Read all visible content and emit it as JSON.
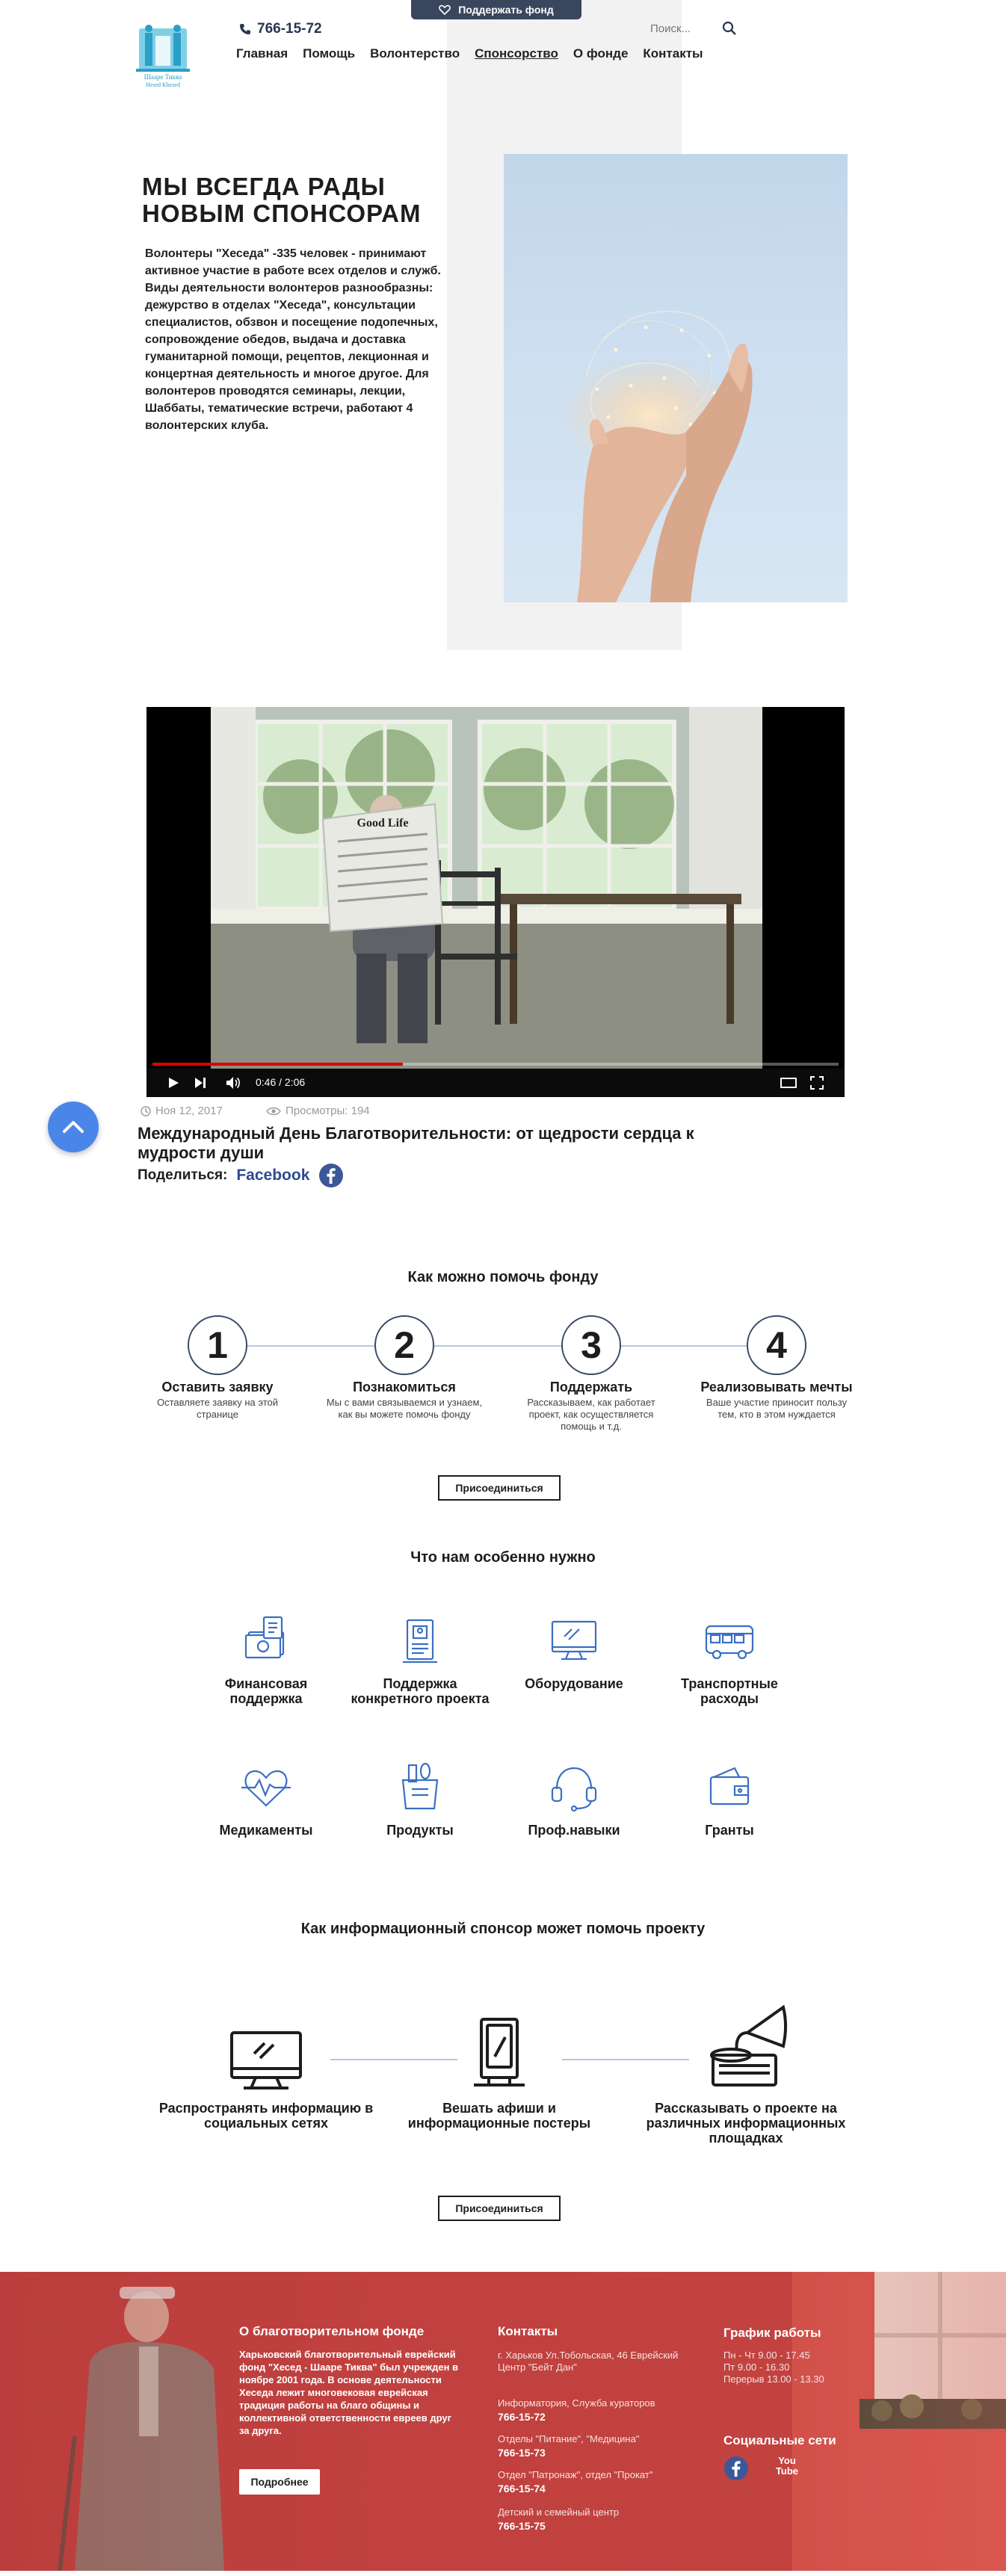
{
  "header": {
    "logo_text": "Шааре Тиква",
    "logo_subtext": "Hesed Khesed",
    "phone": "766-15-72",
    "support_button": "Поддержать фонд",
    "search_placeholder": "Поиск...",
    "nav": [
      "Главная",
      "Помощь",
      "Волонтерство",
      "Спонсорство",
      "О фонде",
      "Контакты"
    ]
  },
  "hero": {
    "title": "МЫ ВСЕГДА РАДЫ НОВЫМ СПОНСОРАМ",
    "text": "Волонтеры \"Хеседа\" -335 человек - принимают активное участие в работе всех отделов и служб. Виды деятельности волонтеров разнообразны: дежурство в отделах \"Хеседа\", консультации специалистов, обзвон и посещение подопечных, сопровождение обедов, выдача и доставка гуманитарной помощи, рецептов, лекционная и концертная деятельность и многое другое. Для волонтеров проводятся семинары, лекции, Шаббаты, тематические встречи, работают 4 волонтерских клуба."
  },
  "video": {
    "time": "0:46 / 2:06",
    "progress": 0.365,
    "newspaper_title": "Good Life"
  },
  "article": {
    "date": "Ноя 12, 2017",
    "views": "Просмотры: 194",
    "title": "Международный День Благотворительности: от щедрости сердца к мудрости души",
    "share_label": "Поделиться:",
    "share_link": "Facebook"
  },
  "steps": {
    "title": "Как  можно помочь фонду",
    "items": [
      {
        "number": "1",
        "title": "Оставить заявку",
        "desc": "Оставляете заявку на этой странице"
      },
      {
        "number": "2",
        "title": "Познакомиться",
        "desc": "Мы с вами связываемся и узнаем, как вы можете помочь фонду"
      },
      {
        "number": "3",
        "title": "Поддержать",
        "desc": "Рассказываем, как работает проект, как осуществляется помощь и т.д."
      },
      {
        "number": "4",
        "title": "Реализовывать мечты",
        "desc": "Ваше участие приносит пользу тем, кто в этом нуждается"
      }
    ],
    "button": "Присоединиться"
  },
  "needs": {
    "title": "Что нам особенно нужно",
    "items": [
      {
        "label": "Финансовая поддержка",
        "icon": "money-icon"
      },
      {
        "label": "Поддержка конкретного проекта",
        "icon": "document-icon"
      },
      {
        "label": "Оборудование",
        "icon": "monitor-icon"
      },
      {
        "label": "Транспортные расходы",
        "icon": "bus-icon"
      },
      {
        "label": "Медикаменты",
        "icon": "heartbeat-icon"
      },
      {
        "label": "Продукты",
        "icon": "grocery-bag-icon"
      },
      {
        "label": "Проф.навыки",
        "icon": "headset-icon"
      },
      {
        "label": "Гранты",
        "icon": "wallet-icon"
      }
    ]
  },
  "info": {
    "title": "Как информационный спонсор может помочь проекту",
    "items": [
      {
        "label": "Распространять информацию в социальных сетях",
        "icon": "computer-icon"
      },
      {
        "label": "Вешать афиши и информационные постеры",
        "icon": "billboard-icon"
      },
      {
        "label": "Рассказывать о проекте на различных информационных площадках",
        "icon": "gramophone-icon"
      }
    ],
    "button": "Присоединиться"
  },
  "footer": {
    "about_title": "О благотворительном фонде",
    "about_text": "Харьковский благотворительный еврейский фонд \"Хесед - Шааре Тиква\" был учрежден в ноябре 2001 года. В основе деятельности Хеседа лежит многовековая еврейская традиция работы на благо общины и коллективной ответственности евреев друг за друга.",
    "about_button": "Подробнее",
    "contacts_title": "Контакты",
    "address": "г. Харьков Ул.Тобольская, 46 Еврейский Центр \"Бейт Дан\"",
    "contacts": [
      {
        "label": "Информатория, Служба кураторов",
        "phone": "766-15-72"
      },
      {
        "label": "Отделы \"Питание\", \"Медицина\"",
        "phone": "766-15-73"
      },
      {
        "label": "Отдел \"Патронаж\", отдел \"Прокат\"",
        "phone": "766-15-74"
      },
      {
        "label": "Детский и семейный центр",
        "phone": "766-15-75"
      }
    ],
    "schedule_title": "График работы",
    "schedule": [
      "Пн - Чт 9.00 - 17.45",
      "Пт 9.00 - 16.30",
      "Перерыв 13.00 - 13.30"
    ],
    "social_title": "Социальные сети",
    "youtube_label": "You Tube"
  }
}
